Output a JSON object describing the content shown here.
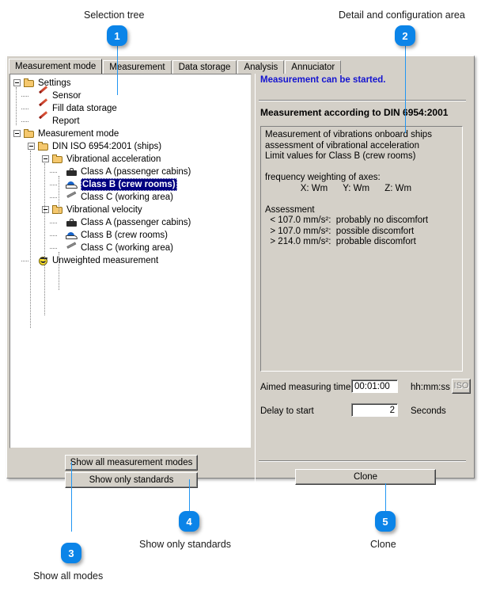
{
  "annotations": {
    "items": [
      {
        "number": "1",
        "caption": "Selection tree"
      },
      {
        "number": "2",
        "caption": "Detail and configuration area"
      },
      {
        "number": "3",
        "caption": "Show all modes"
      },
      {
        "number": "4",
        "caption": "Show only standards"
      },
      {
        "number": "5",
        "caption": "Clone"
      }
    ],
    "accent_color": "#0b84e8"
  },
  "window": {
    "tabs": [
      {
        "label": "Measurement mode",
        "active": true
      },
      {
        "label": "Measurement",
        "active": false
      },
      {
        "label": "Data storage",
        "active": false
      },
      {
        "label": "Analysis",
        "active": false
      },
      {
        "label": "Annuciator",
        "active": false
      }
    ]
  },
  "tree": {
    "nodes": [
      {
        "label": "Settings",
        "icon": "folder-icon",
        "depth": 0,
        "expander": "collapse",
        "selected": false
      },
      {
        "label": "Sensor",
        "icon": "pencil-icon",
        "depth": 1,
        "expander": "none",
        "selected": false
      },
      {
        "label": "Fill data storage",
        "icon": "pencil-icon",
        "depth": 1,
        "expander": "none",
        "selected": false
      },
      {
        "label": "Report",
        "icon": "pencil-icon",
        "depth": 1,
        "expander": "none",
        "selected": false
      },
      {
        "label": "Measurement mode",
        "icon": "folder-icon",
        "depth": 0,
        "expander": "collapse",
        "selected": false
      },
      {
        "label": "DIN ISO 6954:2001 (ships)",
        "icon": "folder-icon",
        "depth": 1,
        "expander": "collapse",
        "selected": false
      },
      {
        "label": "Vibrational acceleration",
        "icon": "folder-icon",
        "depth": 2,
        "expander": "collapse",
        "selected": false
      },
      {
        "label": "Class A (passenger cabins)",
        "icon": "briefcase-icon",
        "depth": 3,
        "expander": "none",
        "selected": false
      },
      {
        "label": "Class B (crew rooms)",
        "icon": "cap-icon",
        "depth": 3,
        "expander": "none",
        "selected": true
      },
      {
        "label": "Class C (working area)",
        "icon": "wrench-icon",
        "depth": 3,
        "expander": "none",
        "selected": false
      },
      {
        "label": "Vibrational velocity",
        "icon": "folder-icon",
        "depth": 2,
        "expander": "collapse",
        "selected": false
      },
      {
        "label": "Class A (passenger cabins)",
        "icon": "briefcase-icon",
        "depth": 3,
        "expander": "none",
        "selected": false
      },
      {
        "label": "Class B (crew rooms)",
        "icon": "cap-icon",
        "depth": 3,
        "expander": "none",
        "selected": false
      },
      {
        "label": "Class C (working area)",
        "icon": "wrench-icon",
        "depth": 3,
        "expander": "none",
        "selected": false
      },
      {
        "label": "Unweighted measurement",
        "icon": "smiley-icon",
        "depth": 1,
        "expander": "none",
        "selected": false
      }
    ]
  },
  "left_buttons": {
    "show_all_label": "Show all measurement modes",
    "show_standards_label": "Show only standards"
  },
  "detail": {
    "status": "Measurement can be started.",
    "status_color": "#1414d0",
    "title": "Measurement according to DIN 6954:2001",
    "description": "Measurement of vibrations onboard ships\nassessment of vibrational acceleration\nLimit values for Class B (crew rooms)\n\nfrequency weighting of axes:\n              X: Wm      Y: Wm      Z: Wm\n\nAssessment\n  < 107.0 mm/s²:  probably no discomfort\n  > 107.0 mm/s²:  possible discomfort\n  > 214.0 mm/s²:  probable discomfort",
    "fields": [
      {
        "label": "Aimed measuring time",
        "value": "00:01:00",
        "unit": "hh:mm:ss",
        "align": "left"
      },
      {
        "label": "Delay to start",
        "value": "2",
        "unit": "Seconds",
        "align": "right"
      }
    ],
    "iso_button_label": "ISO",
    "iso_button_disabled": true,
    "clone_button_label": "Clone"
  }
}
